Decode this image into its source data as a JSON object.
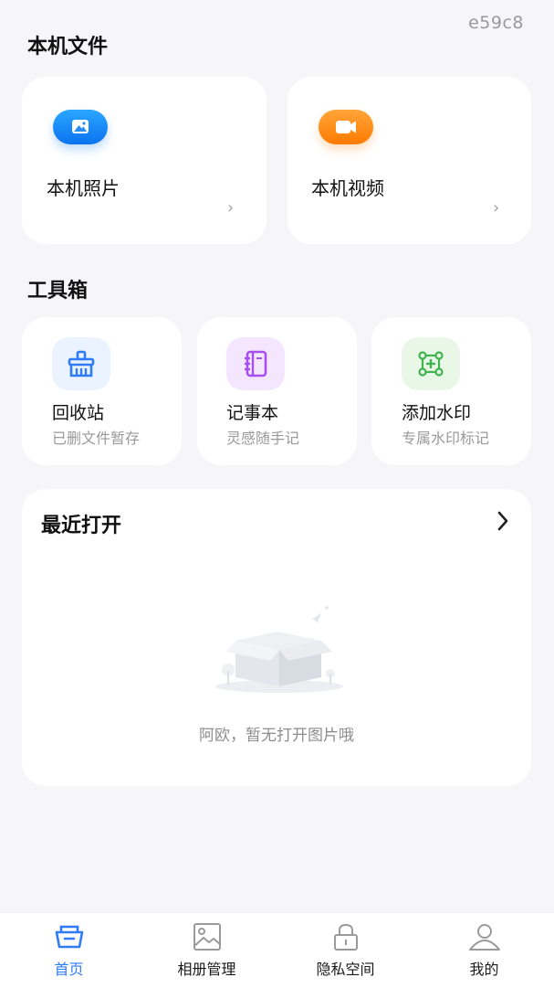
{
  "corner_id": "e59c8",
  "local_files": {
    "title": "本机文件",
    "items": [
      {
        "label": "本机照片",
        "icon": "photo-icon",
        "color": "#1a8cff"
      },
      {
        "label": "本机视频",
        "icon": "video-icon",
        "color": "#ff8c1a"
      }
    ]
  },
  "toolbox": {
    "title": "工具箱",
    "items": [
      {
        "title": "回收站",
        "subtitle": "已删文件暂存",
        "icon": "broom-icon",
        "color": "#2f7cf6"
      },
      {
        "title": "记事本",
        "subtitle": "灵感随手记",
        "icon": "notebook-icon",
        "color": "#a64ef0"
      },
      {
        "title": "添加水印",
        "subtitle": "专属水印标记",
        "icon": "watermark-icon",
        "color": "#3fb34f"
      }
    ]
  },
  "recent": {
    "title": "最近打开",
    "empty_text": "阿欧，暂无打开图片哦"
  },
  "tabbar": {
    "items": [
      {
        "label": "首页",
        "icon": "home-basket-icon",
        "active": true
      },
      {
        "label": "相册管理",
        "icon": "album-icon",
        "active": false
      },
      {
        "label": "隐私空间",
        "icon": "lock-icon",
        "active": false
      },
      {
        "label": "我的",
        "icon": "profile-icon",
        "active": false
      }
    ],
    "active_color": "#2f7cf6"
  }
}
